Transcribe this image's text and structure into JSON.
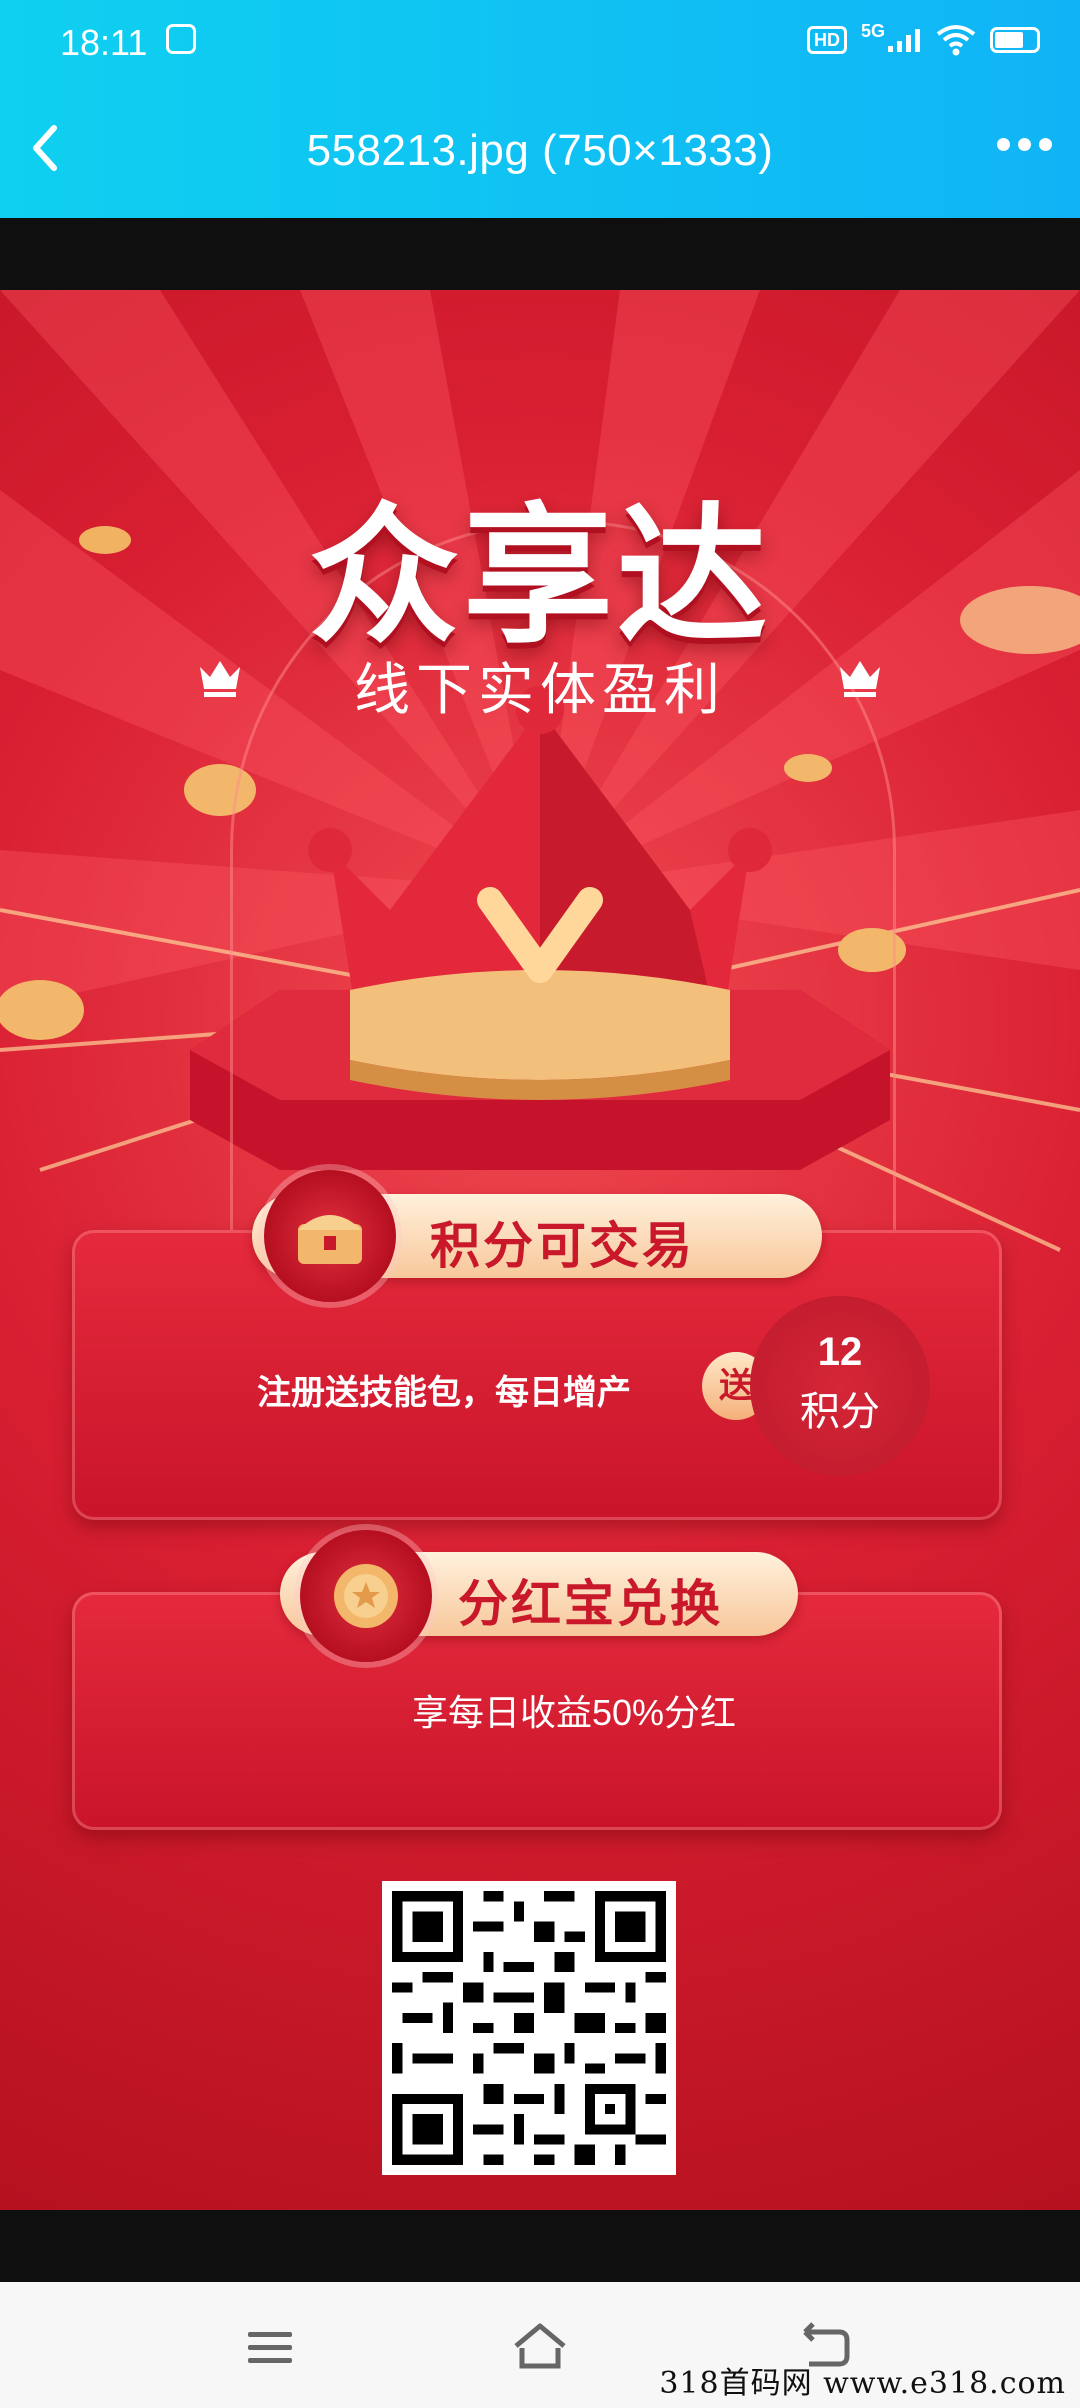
{
  "status_bar": {
    "time": "18:11",
    "hd": "HD",
    "network": "5G"
  },
  "header": {
    "title": "558213.jpg (750×1333)"
  },
  "poster": {
    "brand": "众享达",
    "subtitle": "线下实体盈利",
    "section1": {
      "pill_label": "积分可交易",
      "text": "注册送技能包，每日增产",
      "gift_badge": "送",
      "points_value": "12",
      "points_unit": "积分"
    },
    "section2": {
      "pill_label": "分红宝兑换",
      "text": "享每日收益50%分红"
    }
  },
  "watermark": "318首码网  www.e318.com",
  "colors": {
    "header": "#10c4f4",
    "poster_red": "#d91f32",
    "gold": "#f7c79a"
  }
}
